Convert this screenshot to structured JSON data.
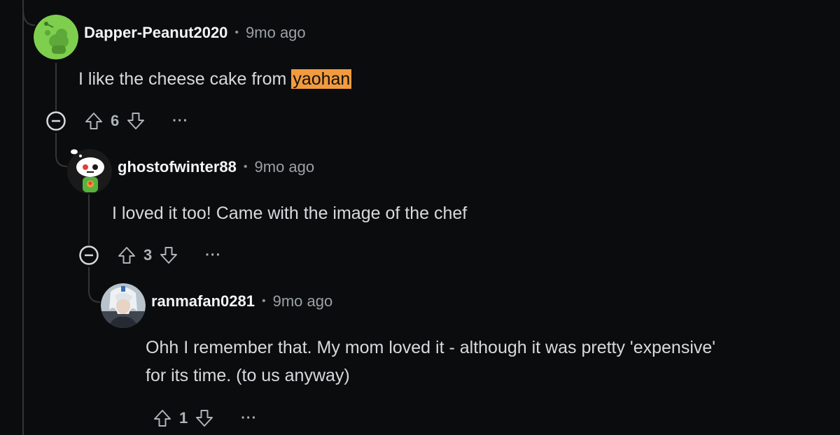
{
  "comments": [
    {
      "username": "Dapper-Peanut2020",
      "separator": "•",
      "time": "9mo ago",
      "text_before": "I like the cheese cake from ",
      "highlight": "yaohan",
      "votes": "6",
      "more": "···",
      "avatar_icon": "snoo-green-avatar-icon"
    },
    {
      "username": "ghostofwinter88",
      "separator": "•",
      "time": "9mo ago",
      "text": "I loved it too! Came with the image of the chef",
      "votes": "3",
      "more": "···",
      "avatar_icon": "snoo-ghost-avatar-icon"
    },
    {
      "username": "ranmafan0281",
      "separator": "•",
      "time": "9mo ago",
      "text_line1": "Ohh I remember that. My mom loved it - although it was pretty 'expensive'",
      "text_line2": "for its time. (to us anyway)",
      "votes": "1",
      "more": "···",
      "avatar_icon": "anime-character-avatar-icon"
    }
  ],
  "colors": {
    "background": "#0b0c0d",
    "thread_line": "#343536",
    "highlight": "#f29b3e",
    "text": "#d7dadc",
    "muted": "#9aa1a6"
  }
}
